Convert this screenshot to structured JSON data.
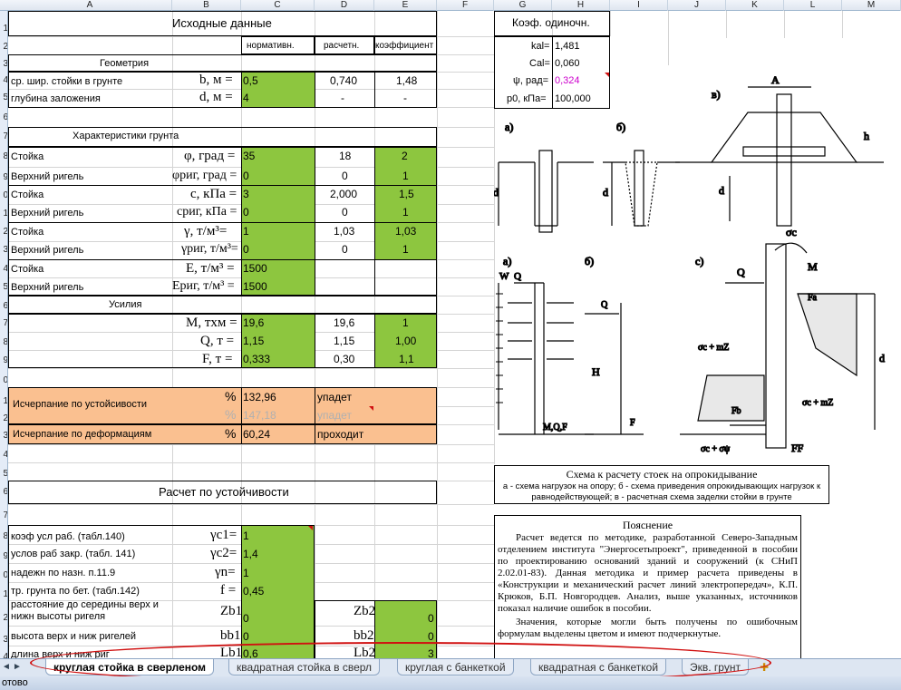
{
  "columns": [
    "A",
    "B",
    "C",
    "D",
    "E",
    "F",
    "G",
    "H",
    "I",
    "J",
    "K",
    "L",
    "M"
  ],
  "rows": [
    "1",
    "2",
    "3",
    "4",
    "5",
    "6",
    "7",
    "8",
    "9",
    "0",
    "1",
    "2",
    "3",
    "4",
    "5",
    "6",
    "7",
    "8",
    "9",
    "0",
    "1",
    "2",
    "3",
    "4",
    "5",
    "6",
    "7",
    "8",
    "9",
    "0",
    "1",
    "2",
    "3",
    "4"
  ],
  "top": {
    "title": "Исходные данные",
    "h_norm": "нормативн.",
    "h_calc": "расчетн.",
    "h_coef": "коэффициент"
  },
  "geom": {
    "title": "Геометрия",
    "r1_label": "ср. шир. стойки в грунте",
    "r1_sym": "b, м =",
    "r1_norm": "0,5",
    "r1_calc": "0,740",
    "r1_coef": "1,48",
    "r2_label": "глубина заложения",
    "r2_sym": "d, м =",
    "r2_norm": "4",
    "r2_calc": "-",
    "r2_coef": "-"
  },
  "soil": {
    "title": "Характеристики грунта",
    "rows": [
      {
        "label": "Стойка",
        "sym": "φ, град =",
        "norm": "35",
        "calc": "18",
        "coef": "2"
      },
      {
        "label": "Верхний ригель",
        "sym": "φриг, град =",
        "norm": "0",
        "calc": "0",
        "coef": "1"
      },
      {
        "label": "Стойка",
        "sym": "c, кПа =",
        "norm": "3",
        "calc": "2,000",
        "coef": "1,5"
      },
      {
        "label": "Верхний ригель",
        "sym": "cриг, кПа =",
        "norm": "0",
        "calc": "0",
        "coef": "1"
      },
      {
        "label": "Стойка",
        "sym": "γ, т/м³=",
        "norm": "1",
        "calc": "1,03",
        "coef": "1,03"
      },
      {
        "label": "Верхний ригель",
        "sym": "γриг, т/м³=",
        "norm": "0",
        "calc": "0",
        "coef": "1"
      },
      {
        "label": "Стойка",
        "sym": "E, т/м³ =",
        "norm": "1500",
        "calc": "",
        "coef": ""
      },
      {
        "label": "Верхний ригель",
        "sym": "Eриг, т/м³ =",
        "norm": "1500",
        "calc": "",
        "coef": ""
      }
    ]
  },
  "forces": {
    "title": "Усилия",
    "rows": [
      {
        "sym": "M, тхм =",
        "norm": "19,6",
        "calc": "19,6",
        "coef": "1"
      },
      {
        "sym": "Q, т =",
        "norm": "1,15",
        "calc": "1,15",
        "coef": "1,00"
      },
      {
        "sym": "F, т =",
        "norm": "0,333",
        "calc": "0,30",
        "coef": "1,1"
      }
    ]
  },
  "result": {
    "stab_label": "Исчерпание по устойсивости",
    "pct": "%",
    "stab_val": "132,96",
    "stab_status": "упадет",
    "stab_val2": "147,18",
    "stab_status2": "упадет",
    "def_label": "Исчерпание по деформациям",
    "def_val": "60,24",
    "def_status": "проходит"
  },
  "calc": {
    "title": "Расчет по устойчивости",
    "rows": [
      {
        "label": "коэф усл раб. (табл.140)",
        "sym": "γc1=",
        "val": "1"
      },
      {
        "label": "услов раб закр. (табл. 141)",
        "sym": "γc2=",
        "val": "1,4"
      },
      {
        "label": "надежн по назн. п.11.9",
        "sym": "γn=",
        "val": "1"
      },
      {
        "label": "тр. грунта по бет. (табл.142)",
        "sym": "f =",
        "val": "0,45"
      }
    ],
    "zb_label1": "расстояние до середины верх и",
    "zb_label2": "нижн высоты ригеля",
    "zb1_sym": "Zb1",
    "zb1_val": "0",
    "zb2_sym": "Zb2",
    "zb2_val": "0",
    "bb_label": "высота верх и ниж ригелей",
    "bb1_sym": "bb1",
    "bb1_val": "0",
    "bb2_sym": "bb2",
    "bb2_val": "0",
    "lb_label": "длина верх и ниж риг",
    "lb1_sym": "Lb1",
    "lb1_val": "0,6",
    "lb2_sym": "Lb2",
    "lb2_val": "3"
  },
  "coef": {
    "title": "Коэф. одиночн.",
    "rows": [
      {
        "k": "kal=",
        "v": "1,481"
      },
      {
        "k": "Cal=",
        "v": "0,060"
      },
      {
        "k": "ψ, рад=",
        "v": "0,324"
      },
      {
        "k": "p0, кПа=",
        "v": "100,000"
      }
    ]
  },
  "diagram": {
    "a": "а)",
    "b": "б)",
    "v": "в)",
    "W": "W",
    "Qgw": "Q",
    "Q0": "Q",
    "MQF": "M,Q,F",
    "Qh": "Q",
    "H": "H",
    "F": "F",
    "FF": "FF",
    "M": "M",
    "sigma_c": "σc",
    "s1": "σc + mZ",
    "s2": "σc + mZ",
    "s3": "σc + σψ",
    "d": "d",
    "h": "h"
  },
  "caption": {
    "title": "Схема к расчету стоек на опрокидывание",
    "text": "а - схема нагрузок на опору; б - схема приведения опрокидывающих нагрузок к равнодействующей; в - расчетная схема заделки стойки в грунте"
  },
  "note": {
    "title": "Пояснение",
    "p1": "Расчет ведется по методике, разработанной Северо-Западным отделением института \"Энергосетьпроект\", приведенной в пособии по проектированию оснований зданий и сооружений (к СНиП 2.02.01-83). Данная методика и пример расчета приведены в «Конструкции и механический расчет линий электропередач», К.П. Крюков, Б.П. Новгородцев. Анализ, выше указанных, источников показал наличие ошибок в пособии.",
    "p2": "Значения, которые могли быть получены по ошибочным формулам выделены цветом и имеют подчеркнутые."
  },
  "tabs": [
    "круглая стойка в сверленом",
    "квадратная стойка в сверл",
    "круглая с банкеткой",
    "квадратная с банкеткой",
    "Экв. грунт"
  ],
  "status": "отово",
  "colors": {
    "green": "#8dc63f",
    "orange": "#fac090",
    "annotation": "#d01010"
  }
}
